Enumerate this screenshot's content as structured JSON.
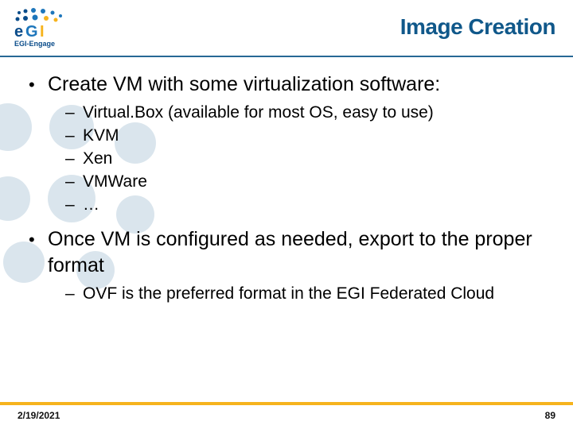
{
  "header": {
    "logo_label": "EGI-Engage",
    "title": "Image Creation"
  },
  "content": {
    "b1_1": "Create VM with some virtualization software:",
    "sub1": {
      "s1": "Virtual.Box (available for most OS, easy to use)",
      "s2": "KVM",
      "s3": "Xen",
      "s4": "VMWare",
      "s5": "…"
    },
    "b1_2": "Once VM is configured as needed, export to the proper format",
    "sub2": {
      "s1": "OVF is the preferred format in the EGI Federated Cloud"
    }
  },
  "footer": {
    "date": "2/19/2021",
    "page": "89"
  }
}
